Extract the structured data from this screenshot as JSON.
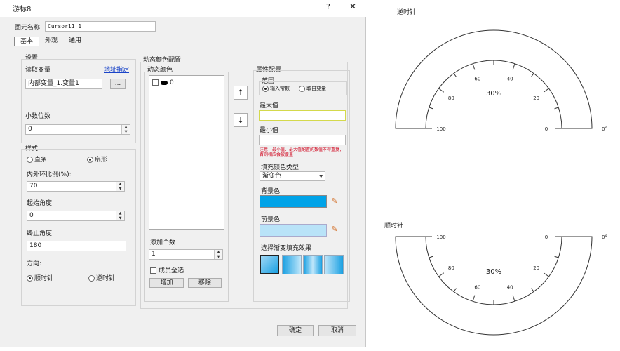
{
  "dialog": {
    "title": "游标8",
    "help_label": "?",
    "close_label": "✕",
    "name_label": "图元名称",
    "name_value": "Cursor11_1",
    "tabs": [
      "基本",
      "外观",
      "通用"
    ],
    "settings": {
      "title": "设置",
      "read_var_label": "读取变量",
      "link_label": "地址指定",
      "var_value": "内部变量_1.变量1",
      "browse_label": "...",
      "decimal_label": "小数位数",
      "decimal_value": "0"
    },
    "style": {
      "title": "样式",
      "option_straight": "直条",
      "option_fan": "扇形",
      "ratio_label": "内外环比例(%):",
      "ratio_value": "70",
      "start_angle_label": "起始角度:",
      "start_angle_value": "0",
      "end_angle_label": "终止角度:",
      "end_angle_value": "180",
      "direction_label": "方向:",
      "option_cw": "顺时针",
      "option_ccw": "逆时针"
    },
    "dynamic_color": {
      "title": "动态颜色配置",
      "list_title": "动态颜色",
      "list_item_value": "0",
      "up_label": "↑",
      "down_label": "↓",
      "add_count_label": "添加个数",
      "add_count_value": "1",
      "select_all_label": "成员全选",
      "add_button": "增加",
      "remove_button": "移除"
    },
    "properties": {
      "title": "属性配置",
      "range_label": "范围",
      "range_option_const": "输入常数",
      "range_option_var": "取自变量",
      "max_label": "最大值",
      "max_value": "",
      "min_label": "最小值",
      "min_value": "",
      "warning": "注意：最小值、最大值配置的数值不得重复，否则相应会被覆盖",
      "fill_type_label": "填充颜色类型",
      "fill_type_value": "渐变色",
      "bg_color_label": "背景色",
      "fg_color_label": "前景色",
      "gradient_label": "选择渐变填充效果"
    },
    "ok_button": "确定",
    "cancel_button": "取消"
  },
  "colors": {
    "background_color": "#00a3e8",
    "foreground_color": "#b9e3f8"
  },
  "gauges": {
    "ccw": {
      "title": "逆时针",
      "value_text": "30%",
      "labels": [
        "100",
        "80",
        "60",
        "40",
        "20",
        "0"
      ],
      "zero_degree": "0°"
    },
    "cw": {
      "title": "顺时针",
      "value_text": "30%",
      "labels": [
        "100",
        "80",
        "60",
        "40",
        "20",
        "0"
      ],
      "zero_degree": "0°"
    }
  }
}
